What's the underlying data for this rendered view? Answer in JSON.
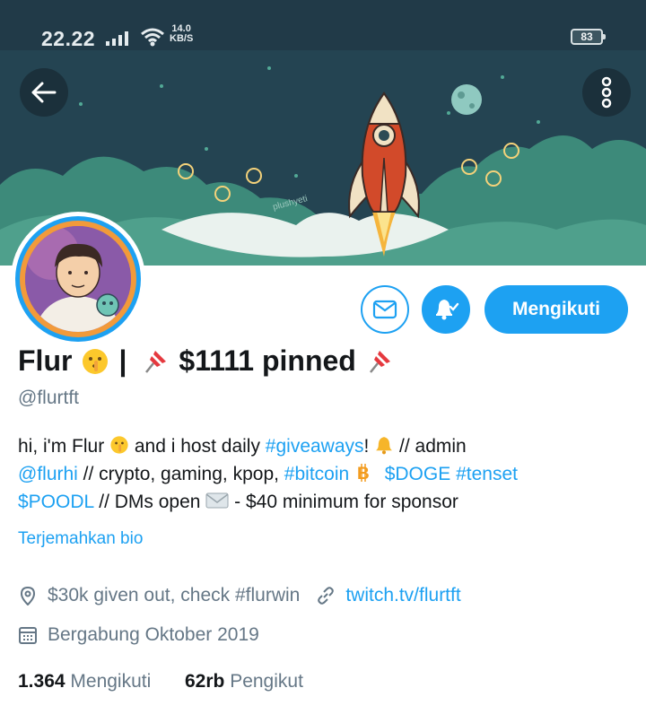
{
  "status_bar": {
    "time": "22.22",
    "net_speed_value": "14.0",
    "net_speed_unit": "KB/S",
    "battery": "83"
  },
  "banner": {
    "watermark": "plushyeti"
  },
  "actions": {
    "follow_label": "Mengikuti"
  },
  "profile": {
    "name_part1": "Flur",
    "name_sep": "|",
    "name_part2": "$1111 pinned",
    "handle": "@flurtft",
    "bio": {
      "t1": "hi, i'm Flur ",
      "t2": " and i host daily ",
      "h_giveaways": "#giveaways",
      "t3": "! ",
      "t4": " // admin",
      "m_flurhi": "@flurhi",
      "t5": " // crypto, gaming, kpop, ",
      "h_bitcoin": "#bitcoin",
      "c_doge": "$DOGE",
      "h_tenset": "#tenset",
      "c_poodl": "$POODL",
      "t6": " // DMs open ",
      "t7": " - $40 minimum for sponsor"
    },
    "translate_label": "Terjemahkan bio",
    "location": "$30k given out, check #flurwin",
    "website": "twitch.tv/flurtft",
    "joined": "Bergabung Oktober 2019",
    "following_count": "1.364",
    "following_label": "Mengikuti",
    "followers_count": "62rb",
    "followers_label": "Pengikut"
  },
  "colors": {
    "accent": "#1da1f2",
    "secondary_text": "#657786",
    "banner_bg": "#244452",
    "status_bar_bg": "#213a48"
  },
  "icons": [
    "back-arrow-icon",
    "more-vertical-icon",
    "mail-icon",
    "bell-check-icon",
    "location-icon",
    "link-icon",
    "calendar-icon",
    "shush-emoji-icon",
    "pushpin-icon",
    "bell-emoji-icon",
    "bitcoin-icon",
    "envelope-emoji-icon"
  ]
}
